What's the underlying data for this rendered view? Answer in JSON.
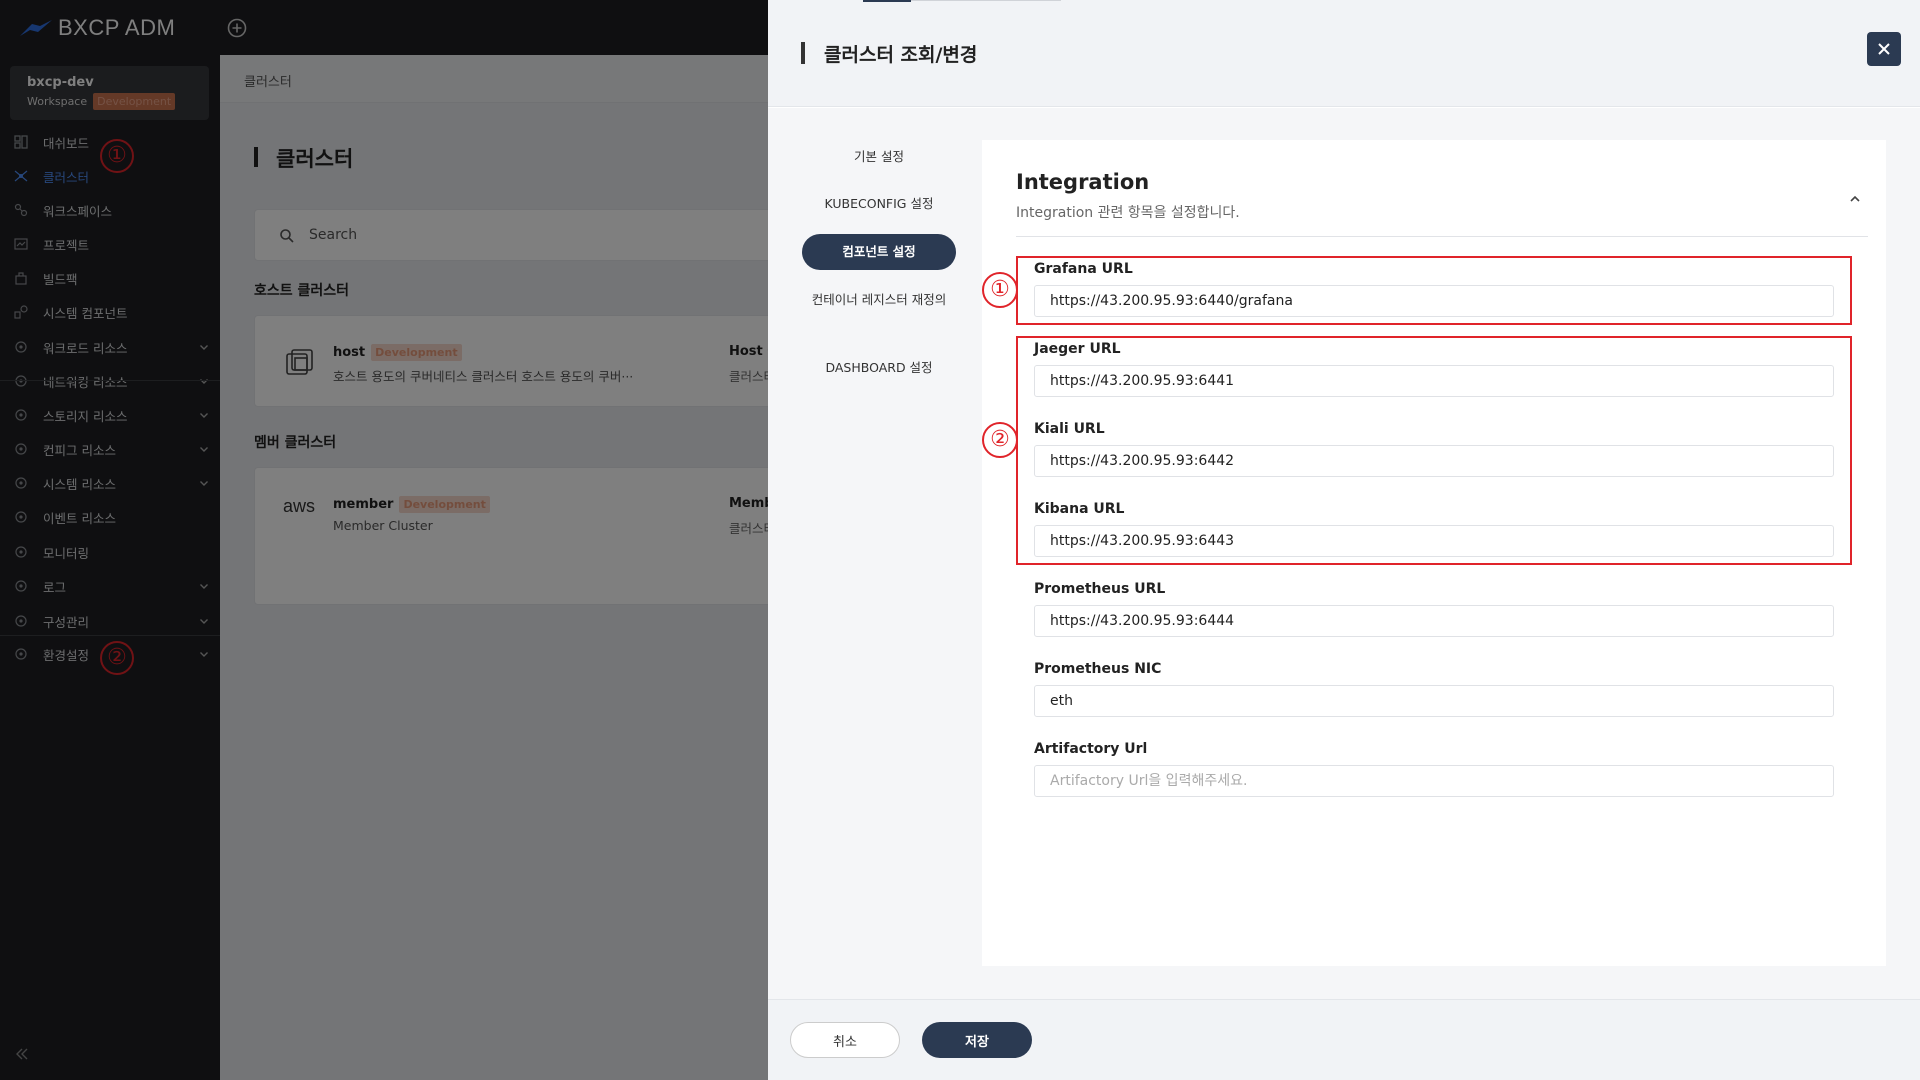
{
  "app": {
    "title": "BXCP ADM"
  },
  "workspace": {
    "name": "bxcp-dev",
    "label": "Workspace",
    "badge": "Development"
  },
  "sidebar": {
    "items": [
      {
        "label": "대쉬보드",
        "icon": "dashboard-icon"
      },
      {
        "label": "클러스터",
        "icon": "cluster-icon",
        "active": true
      },
      {
        "label": "워크스페이스",
        "icon": "workspace-icon"
      },
      {
        "label": "프로젝트",
        "icon": "project-icon"
      },
      {
        "label": "빌드팩",
        "icon": "buildpack-icon"
      },
      {
        "label": "시스템 컴포넌트",
        "icon": "system-component-icon"
      },
      {
        "label": "워크로드 리소스",
        "icon": "workload-icon",
        "expandable": true
      },
      {
        "label": "네트워킹 리소스",
        "icon": "network-icon",
        "expandable": true
      },
      {
        "label": "스토리지 리소스",
        "icon": "storage-icon",
        "expandable": true
      },
      {
        "label": "컨피그 리소스",
        "icon": "config-icon",
        "expandable": true
      },
      {
        "label": "시스템 리소스",
        "icon": "system-resource-icon",
        "expandable": true
      },
      {
        "label": "이벤트 리소스",
        "icon": "event-icon"
      },
      {
        "label": "모니터링",
        "icon": "monitoring-icon"
      },
      {
        "label": "로그",
        "icon": "log-icon",
        "expandable": true
      },
      {
        "label": "구성관리",
        "icon": "config-mgmt-icon",
        "expandable": true
      },
      {
        "label": "환경설정",
        "icon": "settings-icon",
        "expandable": true
      }
    ]
  },
  "annotations": {
    "one": "①",
    "two": "②"
  },
  "main": {
    "breadcrumb": "클러스터",
    "title": "클러스터",
    "search_placeholder": "Search",
    "host_section": "호스트 클러스터",
    "member_section": "멤버 클러스터",
    "host_card": {
      "name": "host",
      "badge": "Development",
      "desc": "호스트 용도의 쿠버네티스 클러스터 호스트 용도의 쿠버···",
      "col_header": "Host Cluste",
      "col_value": "클러스터 명"
    },
    "member_card": {
      "name": "member",
      "badge": "Development",
      "desc": "Member Cluster",
      "col_header": "Member Cl",
      "col_value": "클러스터 명",
      "logo": "aws"
    }
  },
  "drawer": {
    "title": "클러스터 조회/변경",
    "steps": [
      "기본 설정",
      "KUBECONFIG 설정",
      "컴포넌트 설정",
      "컨테이너 레지스터 재정의",
      "DASHBOARD 설정"
    ],
    "active_step": "컴포넌트 설정",
    "section": {
      "title": "Integration",
      "subtitle": "Integration 관련 항목을 설정합니다."
    },
    "fields": [
      {
        "label": "Grafana URL",
        "value": "https://43.200.95.93:6440/grafana",
        "placeholder": ""
      },
      {
        "label": "Jaeger URL",
        "value": "https://43.200.95.93:6441",
        "placeholder": ""
      },
      {
        "label": "Kiali URL",
        "value": "https://43.200.95.93:6442",
        "placeholder": ""
      },
      {
        "label": "Kibana URL",
        "value": "https://43.200.95.93:6443",
        "placeholder": ""
      },
      {
        "label": "Prometheus URL",
        "value": "https://43.200.95.93:6444",
        "placeholder": ""
      },
      {
        "label": "Prometheus NIC",
        "value": "eth",
        "placeholder": ""
      },
      {
        "label": "Artifactory Url",
        "value": "",
        "placeholder": "Artifactory Url을 입력해주세요."
      }
    ],
    "cancel_label": "취소",
    "save_label": "저장"
  },
  "colors": {
    "accent": "#2b3a52",
    "active_nav": "#4f8ef7",
    "annotation": "#e0242a",
    "badge": "#c9724f"
  }
}
